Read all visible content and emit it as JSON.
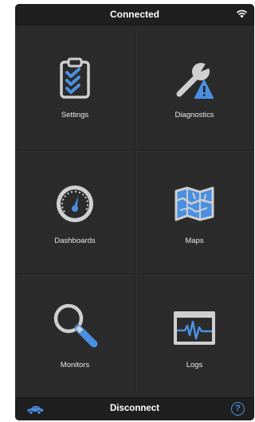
{
  "header": {
    "title": "Connected",
    "wifi_icon": "wifi-icon"
  },
  "menu": {
    "items": [
      {
        "label": "Settings",
        "icon": "clipboard-checklist-icon"
      },
      {
        "label": "Diagnostics",
        "icon": "wrench-warning-icon"
      },
      {
        "label": "Dashboards",
        "icon": "gauge-icon"
      },
      {
        "label": "Maps",
        "icon": "map-icon"
      },
      {
        "label": "Monitors",
        "icon": "magnifier-icon"
      },
      {
        "label": "Logs",
        "icon": "waveform-log-icon"
      }
    ]
  },
  "footer": {
    "title": "Disconnect",
    "left_icon": "car-icon",
    "right_icon": "help-icon",
    "help_glyph": "?"
  },
  "colors": {
    "accent": "#4a90e2",
    "icon_gray": "#cfcfcf",
    "background": "#2b2b2b",
    "bar": "#1f1f1f"
  }
}
